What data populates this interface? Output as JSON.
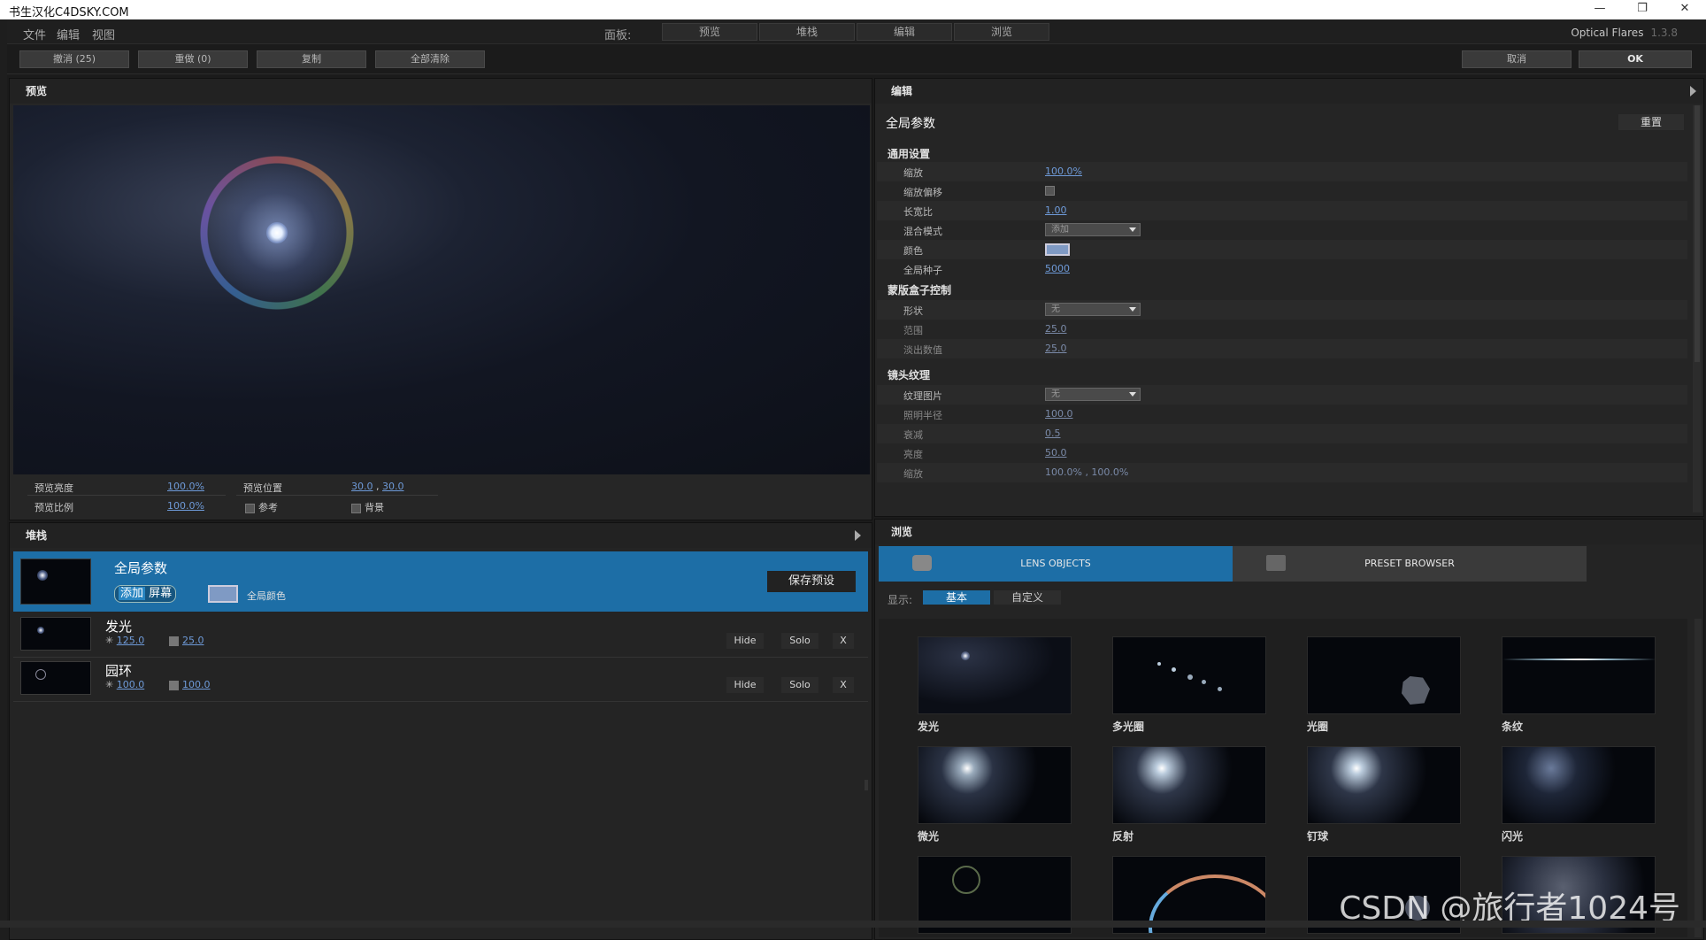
{
  "titlebar": {
    "title": "书生汉化C4DSKY.COM",
    "min": "—",
    "max": "❐",
    "close": "✕"
  },
  "menu": {
    "file": "文件",
    "edit": "编辑",
    "view": "视图",
    "panel_label": "面板:",
    "tabs": [
      "预览",
      "堆栈",
      "编辑",
      "浏览"
    ],
    "brand": "Optical Flares",
    "version": "1.3.8"
  },
  "toolbar": {
    "undo": "撤消 (25)",
    "redo": "重做 (0)",
    "copy": "复制",
    "clear_all": "全部清除",
    "cancel": "取消",
    "ok": "OK"
  },
  "preview": {
    "title": "预览",
    "brightness_label": "预览亮度",
    "brightness": "100.0%",
    "scale_label": "预览比例",
    "scale": "100.0%",
    "position_label": "预览位置",
    "pos_x": "30.0",
    "pos_sep": ",",
    "pos_y": "30.0",
    "reference": "参考",
    "background": "背景"
  },
  "stack": {
    "title": "堆栈",
    "global": {
      "name": "全局参数",
      "blend_a": "添加",
      "blend_b": "屏幕",
      "color_label": "全局颜色",
      "save": "保存预设"
    },
    "items": [
      {
        "name": "发光",
        "a": "125.0",
        "b": "25.0",
        "hide": "Hide",
        "solo": "Solo",
        "x": "X"
      },
      {
        "name": "园环",
        "a": "100.0",
        "b": "100.0",
        "hide": "Hide",
        "solo": "Solo",
        "x": "X"
      }
    ]
  },
  "editor": {
    "title": "编辑",
    "section": "全局参数",
    "reset": "重置",
    "general": {
      "head": "通用设置",
      "scale_l": "缩放",
      "scale": "100.0%",
      "offset_l": "缩放偏移",
      "aspect_l": "长宽比",
      "aspect": "1.00",
      "blend_l": "混合模式",
      "blend": "添加",
      "color_l": "颜色",
      "seed_l": "全局种子",
      "seed": "5000"
    },
    "mask": {
      "head": "蒙版盒子控制",
      "shape_l": "形状",
      "shape": "无",
      "range_l": "范围",
      "range": "25.0",
      "fade_l": "淡出数值",
      "fade": "25.0"
    },
    "texture": {
      "head": "镜头纹理",
      "img_l": "纹理图片",
      "img": "无",
      "radius_l": "照明半径",
      "radius": "100.0",
      "falloff_l": "衰减",
      "falloff": "0.5",
      "bright_l": "亮度",
      "bright": "50.0",
      "trunc_l": "缩放",
      "trunc": "100.0% , 100.0%"
    }
  },
  "browser": {
    "title": "浏览",
    "tab_lens": "LENS OBJECTS",
    "tab_preset": "PRESET BROWSER",
    "show_label": "显示:",
    "basic": "基本",
    "custom": "自定义",
    "items": [
      "发光",
      "多光圈",
      "光圈",
      "条纹",
      "微光",
      "反射",
      "钉球",
      "闪光"
    ]
  },
  "watermark": "CSDN @旅行者1024号",
  "colors": {
    "accent": "#1d6ea6",
    "link": "#6e9ad8"
  }
}
